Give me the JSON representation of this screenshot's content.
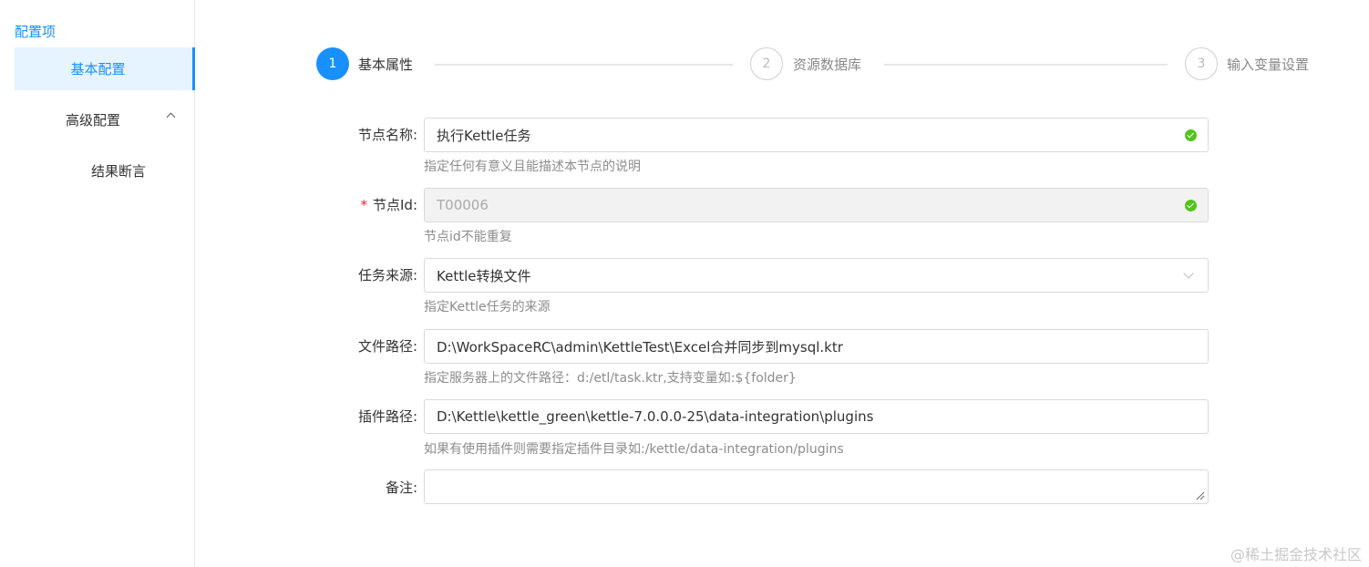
{
  "sidebar": {
    "title": "配置项",
    "items": [
      {
        "label": "基本配置"
      },
      {
        "label": "高级配置"
      },
      {
        "label": "结果断言"
      }
    ]
  },
  "steps": [
    {
      "number": "1",
      "label": "基本属性",
      "status": "active"
    },
    {
      "number": "2",
      "label": "资源数据库",
      "status": "wait"
    },
    {
      "number": "3",
      "label": "输入变量设置",
      "status": "wait"
    }
  ],
  "form": {
    "node_name": {
      "label": "节点名称:",
      "value": "执行Kettle任务",
      "hint": "指定任何有意义且能描述本节点的说明"
    },
    "node_id": {
      "label": "节点Id:",
      "required_mark": "*",
      "value": "T00006",
      "hint": "节点id不能重复"
    },
    "task_source": {
      "label": "任务来源:",
      "value": "Kettle转换文件",
      "hint": "指定Kettle任务的来源"
    },
    "file_path": {
      "label": "文件路径:",
      "value": "D:\\WorkSpaceRC\\admin\\KettleTest\\Excel合并同步到mysql.ktr",
      "hint": "指定服务器上的文件路径：d:/etl/task.ktr,支持变量如:${folder}"
    },
    "plugin_path": {
      "label": "插件路径:",
      "value": "D:\\Kettle\\kettle_green\\kettle-7.0.0.0-25\\data-integration\\plugins",
      "hint": "如果有使用插件则需要指定插件目录如:/kettle/data-integration/plugins"
    },
    "remark": {
      "label": "备注:",
      "value": ""
    }
  },
  "watermark": "@稀土掘金技术社区",
  "colors": {
    "primary": "#1890ff",
    "success": "#52c41a",
    "required": "#f5222d"
  }
}
